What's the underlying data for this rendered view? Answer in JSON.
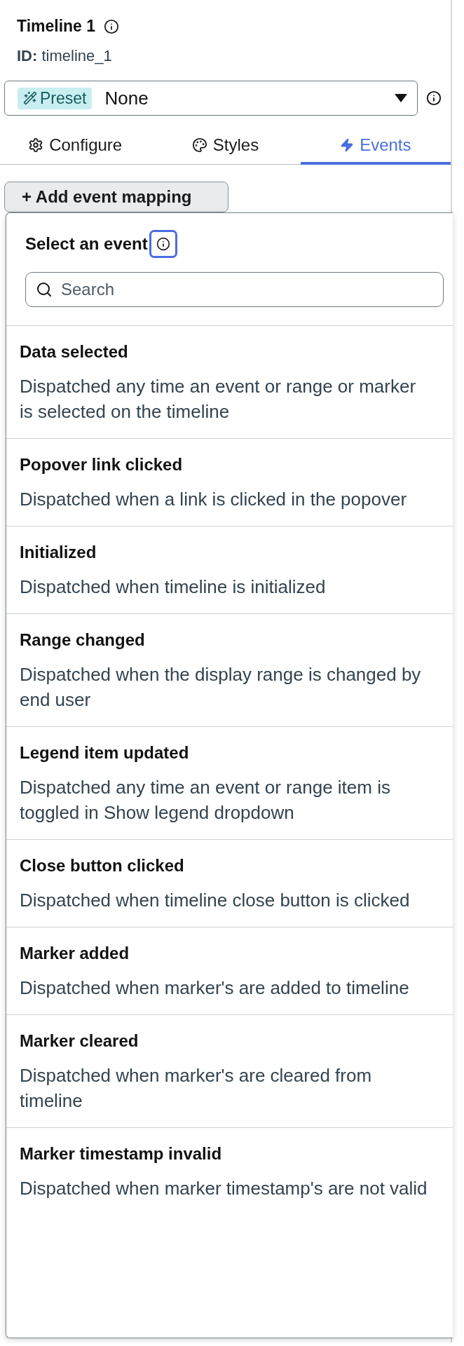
{
  "component": {
    "title": "Timeline 1",
    "id_label": "ID:",
    "id_value": "timeline_1"
  },
  "preset": {
    "badge": "Preset",
    "value": "None"
  },
  "tabs": [
    {
      "label": "Configure",
      "kind": "configure",
      "selected": false
    },
    {
      "label": "Styles",
      "kind": "styles",
      "selected": false
    },
    {
      "label": "Events",
      "kind": "events",
      "selected": true
    }
  ],
  "add_button": {
    "label": "+ Add event mapping"
  },
  "event_picker": {
    "title": "Select an event",
    "info_focused": true,
    "search": {
      "placeholder": "Search"
    },
    "events": [
      {
        "name": "Data selected",
        "description": "Dispatched any time an event or range or marker is selected on the timeline"
      },
      {
        "name": "Popover link clicked",
        "description": "Dispatched when a link is clicked in the popover"
      },
      {
        "name": "Initialized",
        "description": "Dispatched when timeline is initialized"
      },
      {
        "name": "Range changed",
        "description": "Dispatched when the display range is changed by end user"
      },
      {
        "name": "Legend item updated",
        "description": "Dispatched any time an event or range item is toggled in Show legend dropdown"
      },
      {
        "name": "Close button clicked",
        "description": "Dispatched when timeline close button is clicked"
      },
      {
        "name": "Marker added",
        "description": "Dispatched when marker's are added to timeline"
      },
      {
        "name": "Marker cleared",
        "description": "Dispatched when marker's are cleared from timeline"
      },
      {
        "name": "Marker timestamp invalid",
        "description": "Dispatched when marker timestamp's are not valid"
      }
    ]
  }
}
